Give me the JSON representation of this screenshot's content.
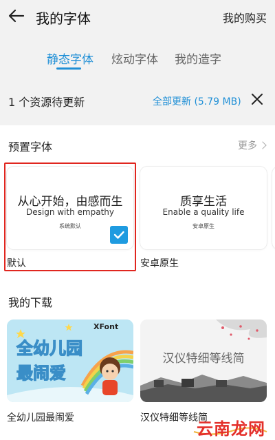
{
  "header": {
    "title": "我的字体",
    "purchase_label": "我的购买"
  },
  "tabs": [
    {
      "label": "静态字体",
      "active": true
    },
    {
      "label": "炫动字体",
      "active": false
    },
    {
      "label": "我的造字",
      "active": false
    }
  ],
  "update_bar": {
    "text": "1 个资源待更新",
    "update_all": "全部更新 (5.79 MB)"
  },
  "preset": {
    "title": "预置字体",
    "more_label": "更多",
    "cards": [
      {
        "main": "从心开始，由感而生",
        "sub": "Design with empathy",
        "tiny": "系统默认",
        "label": "默认",
        "selected": true
      },
      {
        "main": "质享生活",
        "sub": "Enable a quality life",
        "tiny": "安卓原生",
        "label": "安卓原生",
        "selected": false
      }
    ]
  },
  "downloads": {
    "title": "我的下载",
    "cards": [
      {
        "brand": "XFont",
        "art_line1": "全幼儿园",
        "art_line2": "最闹爱",
        "label": "全幼儿园最闹爱"
      },
      {
        "art_text": "汉仪特细等线简",
        "label": "汉仪特细等线简"
      }
    ]
  },
  "watermark": {
    "text": "云南龙网"
  },
  "colors": {
    "accent": "#1f8fd6",
    "highlight_border": "#e0261f",
    "watermark": "#e4302b"
  }
}
